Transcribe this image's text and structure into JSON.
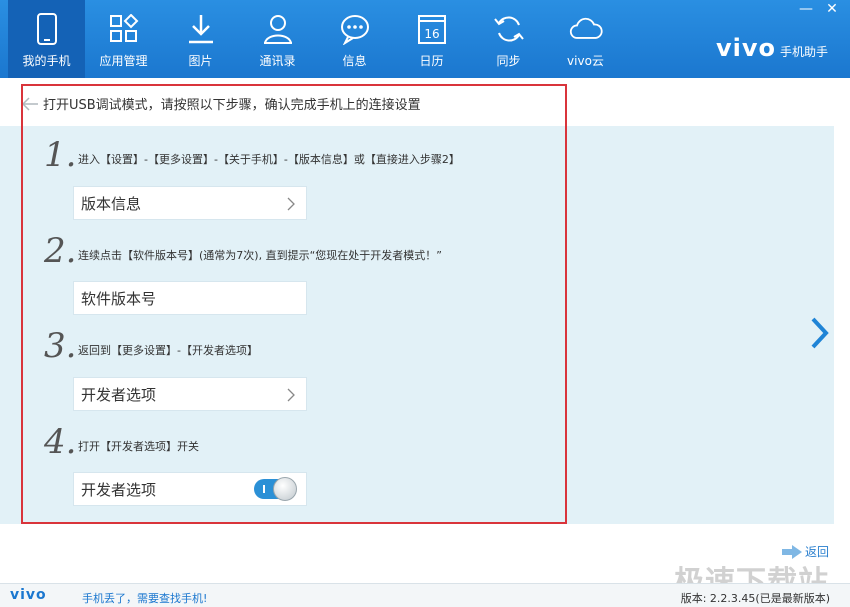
{
  "nav": {
    "items": [
      {
        "label": "我的手机",
        "icon": "phone-icon",
        "active": true
      },
      {
        "label": "应用管理",
        "icon": "apps-icon"
      },
      {
        "label": "图片",
        "icon": "download-icon"
      },
      {
        "label": "通讯录",
        "icon": "contact-icon"
      },
      {
        "label": "信息",
        "icon": "message-icon"
      },
      {
        "label": "日历",
        "icon": "calendar-icon",
        "day": "16"
      },
      {
        "label": "同步",
        "icon": "sync-icon"
      },
      {
        "label": "vivo云",
        "icon": "cloud-icon"
      }
    ]
  },
  "brand": {
    "logo": "vivo",
    "sub": "手机助手"
  },
  "window": {
    "minimize": "—",
    "close": "✕"
  },
  "content": {
    "title": "打开USB调试模式，请按照以下步骤，确认完成手机上的连接设置",
    "steps": [
      {
        "num": "1.",
        "text": "进入【设置】-【更多设置】-【关于手机】-【版本信息】或【直接进入步骤2】",
        "box": "版本信息"
      },
      {
        "num": "2.",
        "text": "连续点击【软件版本号】(通常为7次), 直到提示“您现在处于开发者模式！”",
        "box": "软件版本号"
      },
      {
        "num": "3.",
        "text": "返回到【更多设置】-【开发者选项】",
        "box": "开发者选项"
      },
      {
        "num": "4.",
        "text": "打开【开发者选项】开关",
        "box": "开发者选项",
        "toggle_on": true
      }
    ]
  },
  "footer": {
    "back_label": "返回",
    "logo": "vivo",
    "find_phone": "手机丢了，需要查找手机!",
    "version": "版本: 2.2.3.45(已是最新版本)",
    "watermark": "极速下载站"
  },
  "colors": {
    "accent": "#1b77cf",
    "frame": "#d9343b",
    "panel": "#e2f1f7"
  }
}
